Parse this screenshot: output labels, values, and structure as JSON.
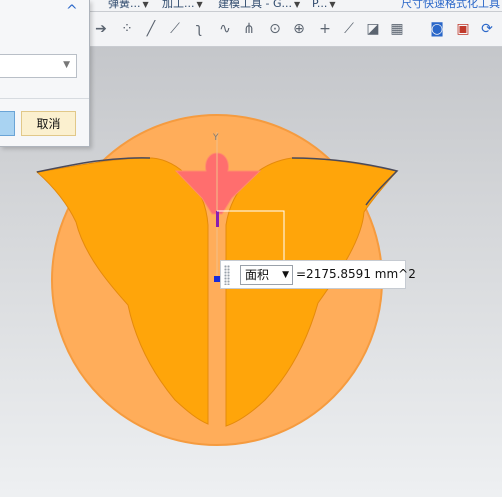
{
  "menu": {
    "items": [
      {
        "label": "弹簧..."
      },
      {
        "label": "加工..."
      },
      {
        "label": "建模工具 - G..."
      },
      {
        "label": "P..."
      }
    ],
    "right_label": "尺寸快速格式化工具"
  },
  "toolbar": {
    "icons": [
      "arrow-right-icon",
      "point-set-icon",
      "line-icon",
      "line-segment-icon",
      "curve-icon",
      "spline-icon",
      "intersection-icon",
      "circle-point-icon",
      "target-icon",
      "plus-icon",
      "line-through-icon",
      "point-sketch-icon",
      "grid-icon",
      "zoom-window-icon",
      "camera-icon",
      "refresh-icon"
    ]
  },
  "dialog": {
    "collapse_glyph": "^",
    "dropdown_value": "",
    "cancel_label": "取消"
  },
  "measure": {
    "type_label": "面积",
    "value_text": "=2175.8591 mm^2"
  },
  "axis": {
    "label": "Y"
  },
  "colors": {
    "disc": "#ffad5a",
    "petal": "#ffa50a",
    "center": "#ff6e6e",
    "accent": "#2a67c9"
  }
}
